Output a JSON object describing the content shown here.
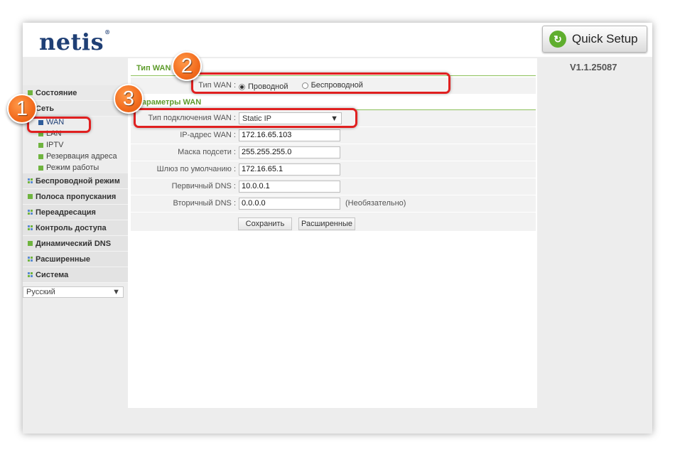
{
  "header": {
    "logo": "netis",
    "logo_mark": "®",
    "quick_setup_label": "Quick Setup",
    "quick_setup_icon": "refresh-arrow-icon",
    "version": "V1.1.25087"
  },
  "sidebar": {
    "status": "Состояние",
    "network": "Сеть",
    "network_items": [
      "WAN",
      "LAN",
      "IPTV",
      "Резервация адреса",
      "Режим работы"
    ],
    "sections": [
      "Беспроводной режим",
      "Полоса пропускания",
      "Переадресация",
      "Контроль доступа",
      "Динамический DNS",
      "Расширенные",
      "Система"
    ],
    "language": "Русский"
  },
  "wan_type": {
    "title": "Тип WAN",
    "label": "Тип WAN :",
    "options": [
      "Проводной",
      "Беспроводной"
    ],
    "selected": "Проводной"
  },
  "wan_params": {
    "title": "Параметры WAN",
    "connection_type_label": "Тип подключения WAN :",
    "connection_type_value": "Static IP",
    "ip_label": "IP-адрес WAN :",
    "ip_value": "172.16.65.103",
    "mask_label": "Маска подсети :",
    "mask_value": "255.255.255.0",
    "gateway_label": "Шлюз по умолчанию :",
    "gateway_value": "172.16.65.1",
    "dns1_label": "Первичный DNS :",
    "dns1_value": "10.0.0.1",
    "dns2_label": "Вторичный DNS :",
    "dns2_value": "0.0.0.0",
    "dns2_note": "(Необязательно)"
  },
  "buttons": {
    "save": "Сохранить",
    "advanced": "Расширенные"
  },
  "annotations": {
    "badge1": "1",
    "badge2": "2",
    "badge3": "3"
  },
  "colors": {
    "accent_green": "#5d9b2a",
    "callout_red": "#e02020",
    "badge_orange": "#f26b1d",
    "logo_blue": "#1f3f75"
  }
}
